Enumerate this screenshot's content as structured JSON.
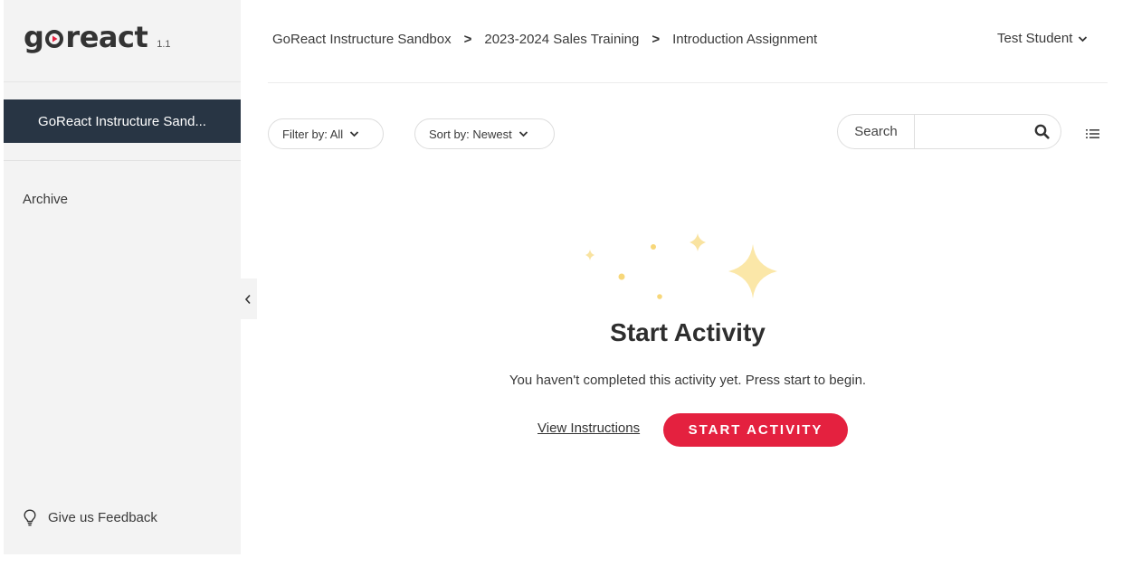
{
  "app": {
    "logo_text": "goreact",
    "version": "1.1"
  },
  "sidebar": {
    "active_item": "GoReact Instructure Sand...",
    "archive_label": "Archive",
    "feedback_label": "Give us Feedback"
  },
  "header": {
    "breadcrumb": [
      "GoReact Instructure Sandbox",
      "2023-2024 Sales Training",
      "Introduction Assignment"
    ],
    "user_name": "Test Student"
  },
  "toolbar": {
    "filter_label": "Filter by: All",
    "sort_label": "Sort by: Newest",
    "search_label": "Search",
    "search_value": ""
  },
  "empty_state": {
    "title": "Start Activity",
    "description": "You haven't completed this activity yet. Press start to begin.",
    "view_instructions": "View Instructions",
    "start_button": "START ACTIVITY"
  },
  "colors": {
    "accent": "#e4213f",
    "sidebar_active_bg": "#283544",
    "sidebar_bg": "#f3f3f3",
    "sparkle": "#f9e3a0"
  },
  "icons": {
    "logo_mark": "play-o-icon",
    "collapse": "chevron-left-icon",
    "feedback": "lightbulb-icon",
    "search": "search-icon",
    "list_view": "list-view-icon",
    "dropdown": "chevron-down-icon",
    "decoration": "sparkles-icon"
  }
}
